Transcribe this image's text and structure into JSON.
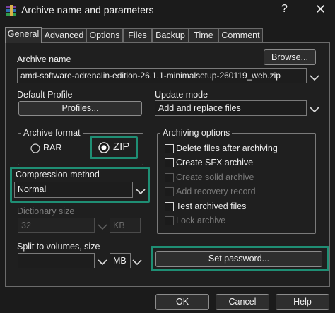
{
  "window": {
    "title": "Archive name and parameters",
    "help_glyph": "?",
    "close_glyph": "✕"
  },
  "tabs": [
    "General",
    "Advanced",
    "Options",
    "Files",
    "Backup",
    "Time",
    "Comment"
  ],
  "archive_name": {
    "label": "Archive name",
    "browse_label": "Browse...",
    "value": "amd-software-adrenalin-edition-26.1.1-minimalsetup-260119_web.zip"
  },
  "default_profile": {
    "label": "Default Profile",
    "button_label": "Profiles..."
  },
  "update_mode": {
    "label": "Update mode",
    "value": "Add and replace files"
  },
  "archive_format": {
    "title": "Archive format",
    "options": [
      "RAR",
      "ZIP"
    ],
    "selected": "ZIP"
  },
  "compression": {
    "label": "Compression method",
    "value": "Normal"
  },
  "dictionary": {
    "label": "Dictionary size",
    "value": "32",
    "unit": "KB"
  },
  "split": {
    "label": "Split to volumes, size",
    "value": "",
    "unit": "MB"
  },
  "archiving_options": {
    "title": "Archiving options",
    "items": [
      {
        "label": "Delete files after archiving",
        "checked": false,
        "enabled": true
      },
      {
        "label": "Create SFX archive",
        "checked": false,
        "enabled": true
      },
      {
        "label": "Create solid archive",
        "checked": false,
        "enabled": false
      },
      {
        "label": "Add recovery record",
        "checked": false,
        "enabled": false
      },
      {
        "label": "Test archived files",
        "checked": false,
        "enabled": true
      },
      {
        "label": "Lock archive",
        "checked": false,
        "enabled": false
      }
    ]
  },
  "set_password_label": "Set password...",
  "footer": {
    "ok": "OK",
    "cancel": "Cancel",
    "help": "Help"
  },
  "colors": {
    "highlight": "#1f8e74",
    "background": "#1f1f1f"
  }
}
